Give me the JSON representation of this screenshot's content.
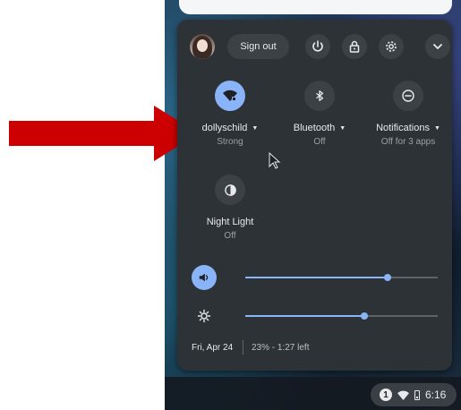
{
  "header": {
    "sign_out_label": "Sign out"
  },
  "features": [
    {
      "label": "dollyschild",
      "sublabel": "Strong",
      "icon": "wifi-icon",
      "has_dropdown": true,
      "active": true
    },
    {
      "label": "Bluetooth",
      "sublabel": "Off",
      "icon": "bluetooth-icon",
      "has_dropdown": true,
      "active": false
    },
    {
      "label": "Notifications",
      "sublabel": "Off for 3 apps",
      "icon": "do-not-disturb-icon",
      "has_dropdown": true,
      "active": false
    },
    {
      "label": "Night Light",
      "sublabel": "Off",
      "icon": "night-light-icon",
      "has_dropdown": false,
      "active": false
    }
  ],
  "sliders": {
    "volume": {
      "icon": "speaker-icon",
      "level": 0.74
    },
    "brightness": {
      "icon": "brightness-icon",
      "level": 0.62
    }
  },
  "footer": {
    "date": "Fri, Apr 24",
    "battery": "23% - 1:27 left"
  },
  "shelf": {
    "notification_count": "1",
    "time": "6:16"
  },
  "colors": {
    "accent": "#8ab4f8",
    "panel": "#2d3237",
    "annotation_arrow": "#cc0000"
  }
}
